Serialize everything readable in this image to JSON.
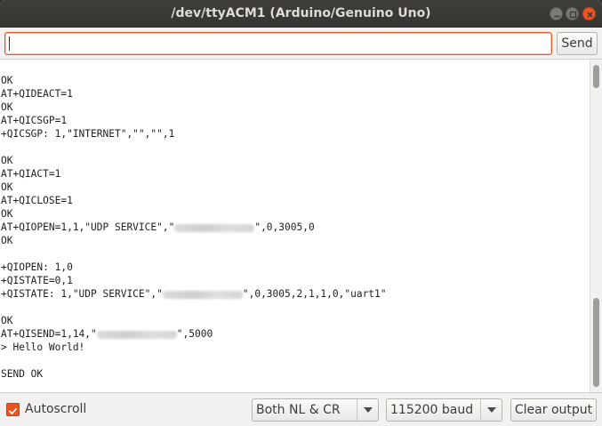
{
  "window": {
    "title": "/dev/ttyACM1 (Arduino/Genuino Uno)"
  },
  "toolbar": {
    "input_value": "",
    "send_label": "Send"
  },
  "console": {
    "lines": [
      {
        "parts": [
          {
            "t": "OK"
          }
        ]
      },
      {
        "parts": [
          {
            "t": "AT+QIDEACT=1"
          }
        ]
      },
      {
        "parts": [
          {
            "t": "OK"
          }
        ]
      },
      {
        "parts": [
          {
            "t": "AT+QICSGP=1"
          }
        ]
      },
      {
        "parts": [
          {
            "t": "+QICSGP: 1,\"INTERNET\",\"\",\"\",1"
          }
        ]
      },
      {
        "parts": [
          {
            "t": ""
          }
        ]
      },
      {
        "parts": [
          {
            "t": "OK"
          }
        ]
      },
      {
        "parts": [
          {
            "t": "AT+QIACT=1"
          }
        ]
      },
      {
        "parts": [
          {
            "t": "OK"
          }
        ]
      },
      {
        "parts": [
          {
            "t": "AT+QICLOSE=1"
          }
        ]
      },
      {
        "parts": [
          {
            "t": "OK"
          }
        ]
      },
      {
        "parts": [
          {
            "t": "AT+QIOPEN=1,1,\"UDP SERVICE\",\""
          },
          {
            "redacted": 12
          },
          {
            "t": "\",0,3005,0"
          }
        ]
      },
      {
        "parts": [
          {
            "t": "OK"
          }
        ]
      },
      {
        "parts": [
          {
            "t": ""
          }
        ]
      },
      {
        "parts": [
          {
            "t": "+QIOPEN: 1,0"
          }
        ]
      },
      {
        "parts": [
          {
            "t": "+QISTATE=0,1"
          }
        ]
      },
      {
        "parts": [
          {
            "t": "+QISTATE: 1,\"UDP SERVICE\",\""
          },
          {
            "redacted": 12
          },
          {
            "t": "\",0,3005,2,1,1,0,\"uart1\""
          }
        ]
      },
      {
        "parts": [
          {
            "t": ""
          }
        ]
      },
      {
        "parts": [
          {
            "t": "OK"
          }
        ]
      },
      {
        "parts": [
          {
            "t": "AT+QISEND=1,14,\""
          },
          {
            "redacted": 12
          },
          {
            "t": "\",5000"
          }
        ]
      },
      {
        "parts": [
          {
            "t": "> Hello World!"
          }
        ]
      },
      {
        "parts": [
          {
            "t": ""
          }
        ]
      },
      {
        "parts": [
          {
            "t": "SEND OK"
          }
        ]
      }
    ]
  },
  "footer": {
    "autoscroll_label": "Autoscroll",
    "autoscroll_checked": true,
    "line_ending": "Both NL & CR",
    "baud_rate": "115200 baud",
    "clear_label": "Clear output"
  },
  "colors": {
    "accent": "#e95420",
    "titlebar": "#3c3b37"
  }
}
